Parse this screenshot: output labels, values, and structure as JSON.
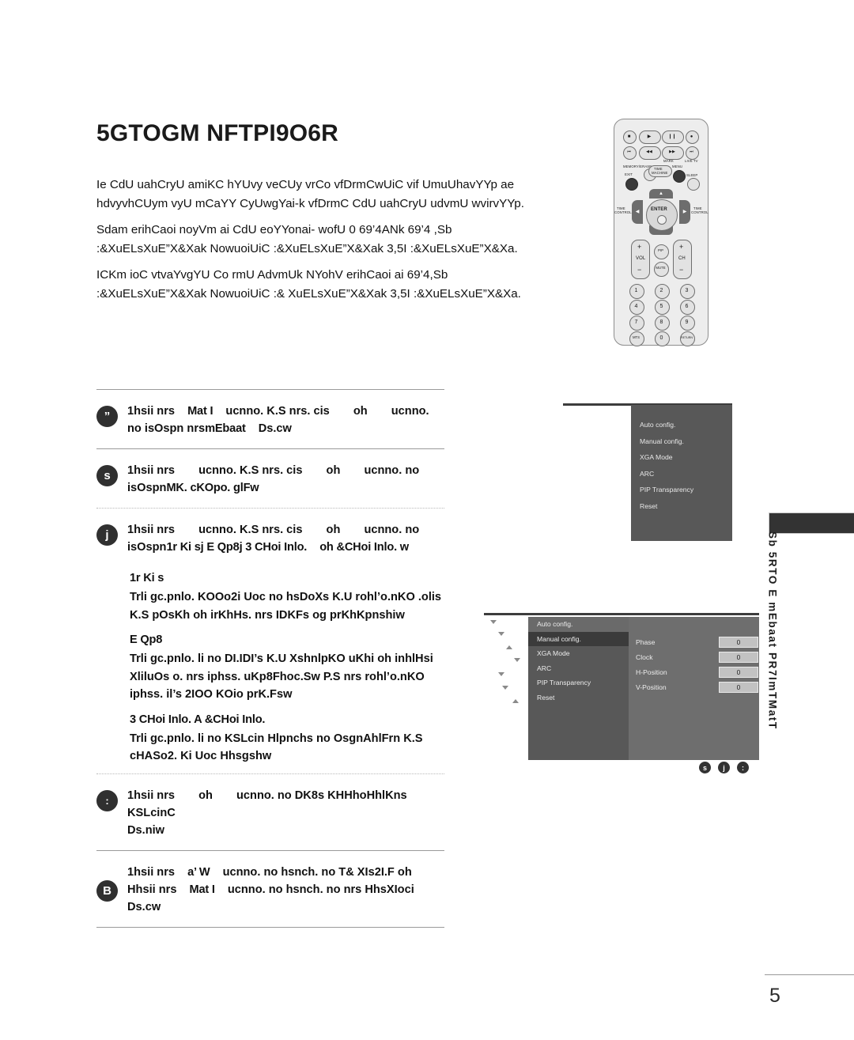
{
  "document": {
    "title": "5GTOGM NFTPI9O6R",
    "page_number": "5",
    "side_tab_text": "Sb 5RTO  E mEbaat PR7ImTMatT"
  },
  "intro": {
    "paragraphs": [
      "Ie CdU uahCryU amiKC hYUvy veCUy vrCo vfDrmCwUiC vif UmuUhavYYp ae hdvyvhCUym vyU mCaYY CyUwgYai-k vfDrmC CdU uahCryU udvmU wvirvYYp.",
      "Sdam erihCaoi noyVm ai CdU eoYYonai- wofU 0 69’4ANk 69’4 ,Sb :&XuELsXuE”X&Xak NowuoiUiC :&XuELsXuE”X&Xak 3,5I :&XuELsXuE”X&Xa.",
      "ICKm ioC vtvaYvgYU Co rmU AdvmUk NYohV erihCaoi ai 69’4,Sb :&XuELsXuE”X&Xak NowuoiUiC :&  XuELsXuE”X&Xak 3,5I :&XuELsXuE”X&Xa."
    ]
  },
  "steps": [
    {
      "badge": "”",
      "line1_a": "1hsii nrs",
      "line1_b": "Mat I",
      "line1_c": "ucnno. K.S nrs. cis",
      "line1_d": "oh",
      "line1_e": "ucnno.",
      "line2_a": "no isOspn nrs",
      "line2_b": "mEbaat",
      "line2_c": "Ds.cw"
    },
    {
      "badge": "s",
      "line1_a": "1hsii nrs",
      "line1_b": "",
      "line1_c": "ucnno. K.S nrs. cis",
      "line1_d": "oh",
      "line1_e": "ucnno. no",
      "line2_a": "isOspn",
      "line2_b": "MK. cKOpo. glFw",
      "line2_c": ""
    },
    {
      "badge": "j",
      "line1_a": "1hsii nrs",
      "line1_b": "",
      "line1_c": "ucnno. K.S nrs. cis",
      "line1_d": "oh",
      "line1_e": "ucnno. no",
      "line2_a": "isOspn",
      "line2_b": "1r Ki sj E Qp8j 3 CHoi Inlo.",
      "line2_c": "oh &CHoi Inlo. w"
    }
  ],
  "definitions": [
    {
      "term": "1r Ki s",
      "body": "Trli gc.pnlo. KOOo2i Uoc no hsDoXs K.U rohl’o.nKO .olis K.S pOsKh oh irKhHs. nrs IDKFs og prKhKpnshiw"
    },
    {
      "term": "E Qp8",
      "body": "Trli gc.pnlo. li no DI.IDI’s K.U XshnlpKO uKhi oh inhlHsi XliluOs o. nrs iphss. uKp8Fhoc.Sw P.S nrs rohl’o.nKO iphss. il’s 2IOO KOio prK.Fsw"
    },
    {
      "term": "3 CHoi Inlo.  A &CHoi Inlo.",
      "body": "Trli gc.pnlo. li no KSLcin Hlpnchs no OsgnAhlFrn K.S cHASo2. Ki Uoc Hhsgshw"
    }
  ],
  "steps_tail": [
    {
      "badge": ":",
      "line1_a": "1hsii nrs",
      "line1_b": "",
      "line1_c": "",
      "line1_d": "oh",
      "line1_e": "ucnno. no DK8s KHHhoHhlKns KSLcinC",
      "line2_a": "Ds.niw",
      "line2_b": "",
      "line2_c": ""
    },
    {
      "badge": "B",
      "line1_a": "1hsii nrs",
      "line1_b": "a’ W",
      "line1_c": "ucnno. no hsnch. no T& XIs2I.F oh",
      "line1_d": "",
      "line1_e": "",
      "line2_a": "Hhsii nrs",
      "line2_b": "Mat I",
      "line2_c": "ucnno. no hsnch. no nrs HhsXIoci",
      "line3": "Ds.cw"
    }
  ],
  "remote": {
    "name": "tv-remote-control",
    "labels": {
      "memory_erase": "MEMORY/ERASE",
      "time_machine_1": "TIME",
      "time_machine_2": "MACHINE",
      "menu": "MENU",
      "exit": "EXIT",
      "sleep": "SLEEP",
      "mark": "MARK",
      "live_tv": "LIVE TV",
      "time_control_left_1": "TIME",
      "time_control_left_2": "CONTROL",
      "time_control_right_1": "TIME",
      "time_control_right_2": "CONTROL",
      "enter": "ENTER",
      "vol": "VOL",
      "ch": "CH",
      "pip": "PIP",
      "mute": "MUTE",
      "mts": "MTS",
      "return": "RETURN",
      "plus": "+",
      "minus": "−"
    },
    "transport_icons": [
      "stop-icon",
      "play-icon",
      "pause-icon",
      "record-icon",
      "skip-back-icon",
      "rewind-icon",
      "fast-forward-icon",
      "skip-forward-icon"
    ],
    "transport_glyphs": [
      "■",
      "▶",
      "❙❙",
      "●",
      "⏮",
      "◀◀",
      "▶▶",
      "⏭"
    ],
    "keypad": [
      "1",
      "2",
      "3",
      "4",
      "5",
      "6",
      "7",
      "8",
      "9",
      "MTS",
      "0",
      "RETURN"
    ],
    "dpad_glyphs": {
      "up": "▲",
      "down": "▼",
      "left": "◀",
      "right": "▶"
    }
  },
  "osd_menu_1": {
    "name": "osd-screen-menu-list",
    "items": [
      "Auto config.",
      "Manual config.",
      "XGA Mode",
      "ARC",
      "PIP Transparency",
      "Reset"
    ]
  },
  "osd_menu_2": {
    "name": "osd-screen-menu-manual-config",
    "items": [
      "Auto config.",
      "Manual config.",
      "XGA Mode",
      "ARC",
      "PIP Transparency",
      "Reset"
    ],
    "selected_item": "Manual config.",
    "settings": [
      {
        "label": "Phase",
        "value": "0"
      },
      {
        "label": "Clock",
        "value": "0"
      },
      {
        "label": "H-Position",
        "value": "0"
      },
      {
        "label": "V-Position",
        "value": "0"
      }
    ],
    "footer_icons": [
      "s",
      "j",
      ":"
    ]
  },
  "colors": {
    "osd_panel": "#585858",
    "osd_panel_right": "#6e6e6e",
    "osd_highlight": "#3b3b3b",
    "badge": "#303030",
    "value_box": "#c2c2c2"
  }
}
